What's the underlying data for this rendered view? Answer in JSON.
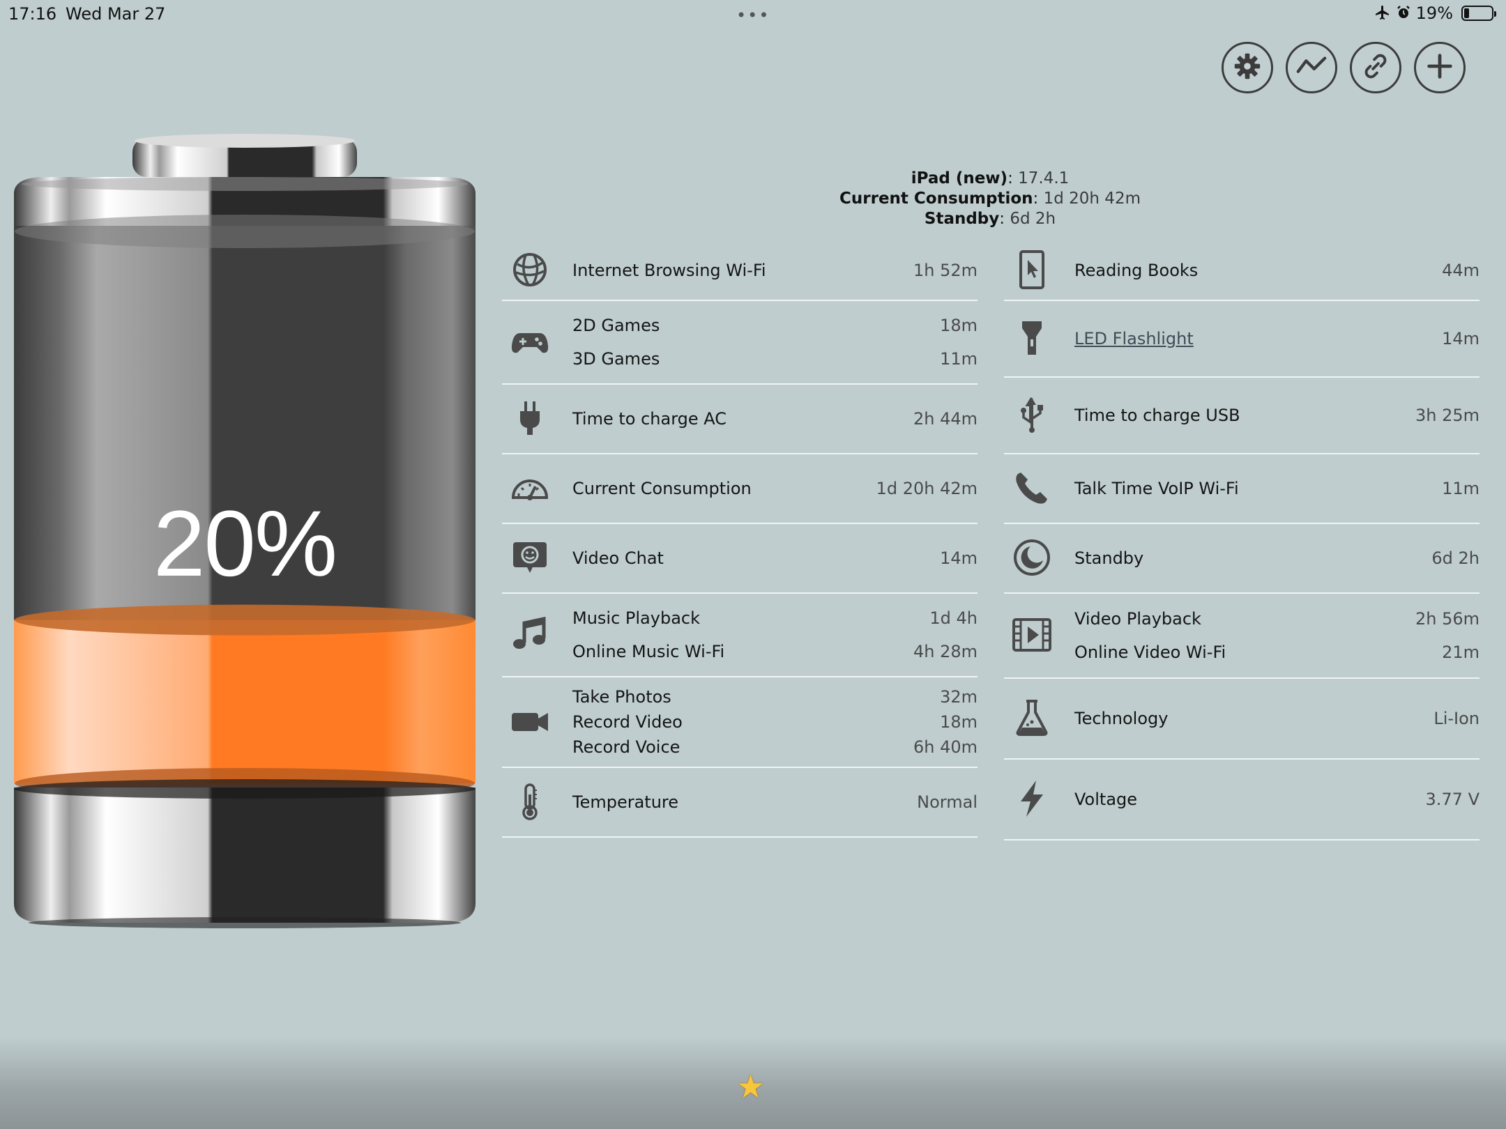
{
  "status_bar": {
    "time": "17:16",
    "date": "Wed Mar 27",
    "dots": "•••",
    "battery_percent": "19%",
    "battery_level": 0.19
  },
  "toolbar": {
    "buttons": [
      {
        "icon": "gear-icon"
      },
      {
        "icon": "chart-icon"
      },
      {
        "icon": "link-icon"
      },
      {
        "icon": "plus-icon"
      }
    ]
  },
  "battery": {
    "percent_label": "20%",
    "level": 0.2,
    "fill_color": "#ff7a22"
  },
  "info": {
    "device_label": "iPad (new)",
    "device_value": "17.4.1",
    "consumption_label": "Current Consumption",
    "consumption_value": "1d 20h 42m",
    "standby_label": "Standby",
    "standby_value": "6d 2h"
  },
  "left_rows": [
    {
      "icon": "globe-icon",
      "lines": [
        {
          "label": "Internet Browsing Wi-Fi",
          "value": "1h 52m"
        }
      ]
    },
    {
      "icon": "gamepad-icon",
      "lines": [
        {
          "label": "2D Games",
          "value": "18m"
        },
        {
          "label": "3D Games",
          "value": "11m"
        }
      ]
    },
    {
      "icon": "plug-icon",
      "lines": [
        {
          "label": "Time to charge AC",
          "value": "2h 44m"
        }
      ]
    },
    {
      "icon": "speedometer-icon",
      "lines": [
        {
          "label": "Current Consumption",
          "value": "1d 20h 42m"
        }
      ]
    },
    {
      "icon": "video-chat-icon",
      "lines": [
        {
          "label": "Video Chat",
          "value": "14m"
        }
      ]
    },
    {
      "icon": "music-note-icon",
      "lines": [
        {
          "label": "Music Playback",
          "value": "1d 4h"
        },
        {
          "label": "Online Music Wi-Fi",
          "value": "4h 28m"
        }
      ]
    },
    {
      "icon": "camera-icon",
      "lines": [
        {
          "label": "Take Photos",
          "value": "32m"
        },
        {
          "label": "Record Video",
          "value": "18m"
        },
        {
          "label": "Record Voice",
          "value": "6h 40m"
        }
      ]
    },
    {
      "icon": "thermometer-icon",
      "lines": [
        {
          "label": "Temperature",
          "value": "Normal"
        }
      ]
    }
  ],
  "right_rows": [
    {
      "icon": "ebook-icon",
      "lines": [
        {
          "label": "Reading Books",
          "value": "44m"
        }
      ]
    },
    {
      "icon": "flashlight-icon",
      "lines": [
        {
          "label": "LED Flashlight",
          "value": "14m",
          "link": true
        }
      ]
    },
    {
      "icon": "usb-icon",
      "lines": [
        {
          "label": "Time to charge USB",
          "value": "3h 25m"
        }
      ]
    },
    {
      "icon": "phone-icon",
      "lines": [
        {
          "label": "Talk Time VoIP Wi-Fi",
          "value": "11m"
        }
      ]
    },
    {
      "icon": "moon-icon",
      "lines": [
        {
          "label": "Standby",
          "value": "6d 2h"
        }
      ]
    },
    {
      "icon": "film-icon",
      "lines": [
        {
          "label": "Video Playback",
          "value": "2h 56m"
        },
        {
          "label": "Online Video Wi-Fi",
          "value": "21m"
        }
      ]
    },
    {
      "icon": "flask-icon",
      "lines": [
        {
          "label": "Technology",
          "value": "Li-Ion"
        }
      ]
    },
    {
      "icon": "lightning-icon",
      "lines": [
        {
          "label": "Voltage",
          "value": "3.77 V"
        }
      ]
    }
  ],
  "bottom": {
    "star_icon": "star-icon"
  }
}
